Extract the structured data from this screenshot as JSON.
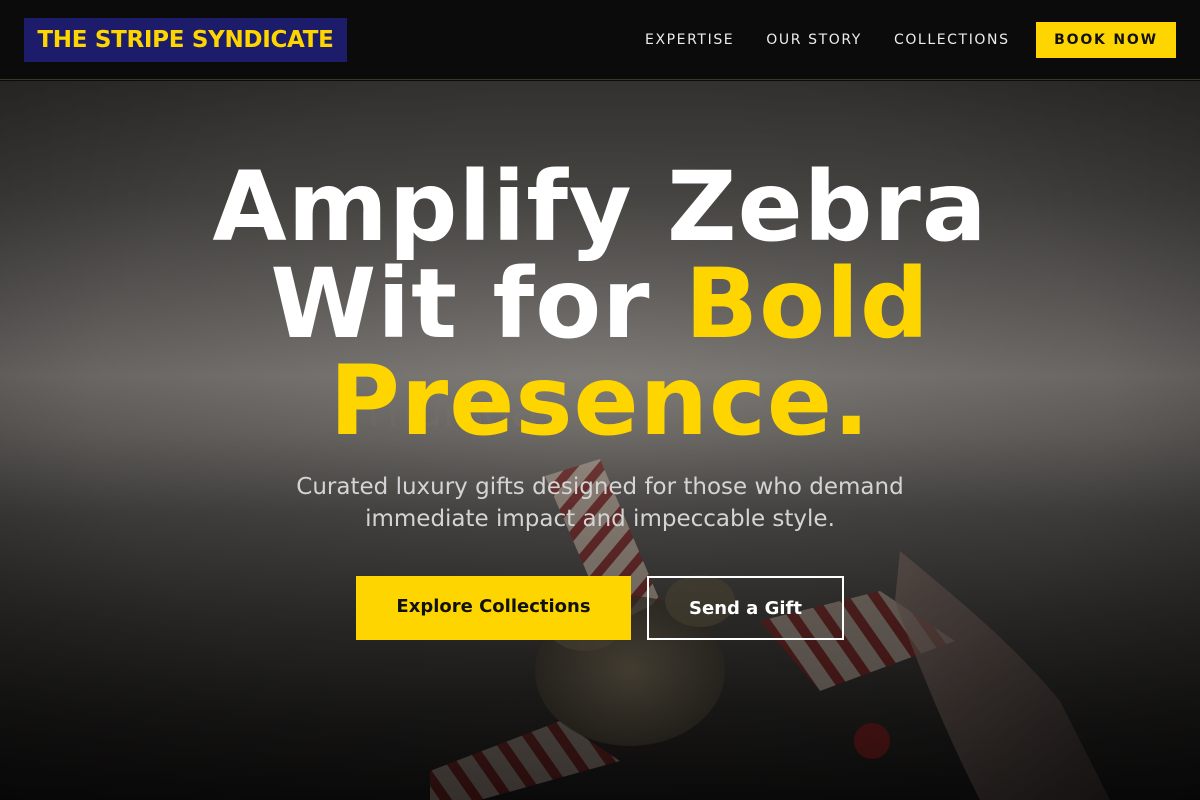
{
  "brand": {
    "name": "THE STRIPE SYNDICATE",
    "accent_color": "#ffd500",
    "logo_bg_color": "#1c1c6b"
  },
  "nav": {
    "items": [
      {
        "label": "EXPERTISE"
      },
      {
        "label": "OUR STORY"
      },
      {
        "label": "COLLECTIONS"
      }
    ],
    "cta_label": "BOOK NOW"
  },
  "hero": {
    "headline_line1": "Amplify Zebra",
    "headline_line2_plain": "Wit for ",
    "headline_line2_accent": "Bold",
    "headline_line3_accent": "Presence.",
    "subheadline_line1": "Curated luxury gifts designed for those who demand",
    "subheadline_line2": "immediate impact and impeccable style.",
    "primary_button": "Explore Collections",
    "secondary_button": "Send a Gift",
    "background_image": "wrapped-gift-striped-ribbon-image"
  }
}
